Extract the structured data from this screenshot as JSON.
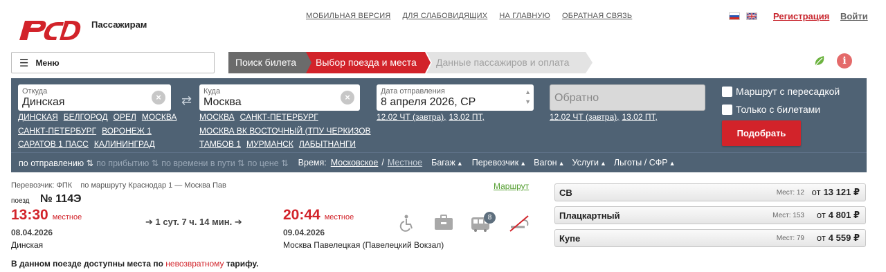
{
  "header": {
    "brand_title": "Пассажирам",
    "nav": [
      "МОБИЛЬНАЯ ВЕРСИЯ",
      "ДЛЯ СЛАБОВИДЯЩИХ",
      "НА ГЛАВНУЮ",
      "ОБРАТНАЯ СВЯЗЬ"
    ],
    "register": "Регистрация",
    "login": "Войти"
  },
  "menu": {
    "label": "Меню"
  },
  "steps": [
    "Поиск билета",
    "Выбор поезда и места",
    "Данные пассажиров и оплата"
  ],
  "search": {
    "from": {
      "label": "Откуда",
      "value": "Динская",
      "quick": [
        [
          "ДИНСКАЯ",
          "БЕЛГОРОД",
          "ОРЕЛ",
          "МОСКВА"
        ],
        [
          "САНКТ-ПЕТЕРБУРГ",
          "ВОРОНЕЖ 1"
        ],
        [
          "САРАТОВ 1 ПАСС",
          "КАЛИНИНГРАД"
        ]
      ]
    },
    "to": {
      "label": "Куда",
      "value": "Москва",
      "quick": [
        [
          "МОСКВА",
          "САНКТ-ПЕТЕРБУРГ"
        ],
        [
          "МОСКВА ВК ВОСТОЧНЫЙ (ТПУ ЧЕРКИЗОВ"
        ],
        [
          "ТАМБОВ 1",
          "МУРМАНСК",
          "ЛАБЫТНАНГИ"
        ]
      ]
    },
    "date": {
      "label": "Дата отправления",
      "value": "8 апреля 2026, СР",
      "quick": [
        "12.02 ЧТ (завтра),",
        "13.02 ПТ,"
      ]
    },
    "back": {
      "placeholder": "Обратно",
      "quick": [
        "12.02 ЧТ (завтра),",
        "13.02 ПТ,"
      ]
    },
    "transfer_label": "Маршрут с пересадкой",
    "tickets_only_label": "Только с билетами",
    "submit": "Подобрать"
  },
  "sortbar": {
    "by_departure": "по отправлению",
    "by_arrival": "по прибытию",
    "by_travel_time": "по времени в пути",
    "by_price": "по цене",
    "time_label": "Время:",
    "time_moscow": "Московское",
    "time_sep": "/",
    "time_local": "Местное",
    "baggage": "Багаж",
    "carrier": "Перевозчик",
    "wagon": "Вагон",
    "services": "Услуги",
    "benefits": "Льготы / СФР"
  },
  "train": {
    "carrier_line": "Перевозчик: ФПК    по маршруту Краснодар 1 — Москва Пав",
    "route_link": "Маршрут",
    "train_label": "поезд",
    "number": "№ 114Э",
    "departure": {
      "time": "13:30",
      "note": "местное",
      "date": "08.04.2026",
      "station": "Динская"
    },
    "duration": "1 сут. 7 ч. 14 мин.",
    "arrival": {
      "time": "20:44",
      "note": "местное",
      "date": "09.04.2026",
      "station": "Москва Павелецкая (Павелецкий Вокзал)"
    },
    "wagon_badge": "8",
    "notice_prefix": "В данном поезде доступны места по",
    "notice_highlight": "невозвратному",
    "notice_suffix": "тарифу."
  },
  "classes": [
    {
      "name": "СВ",
      "seats": "Мест: 12",
      "from": "от",
      "price": "13 121 ₽"
    },
    {
      "name": "Плацкартный",
      "seats": "Мест: 153",
      "from": "от",
      "price": "4 801 ₽"
    },
    {
      "name": "Купе",
      "seats": "Мест: 79",
      "from": "от",
      "price": "4 559 ₽"
    }
  ],
  "colors": {
    "brand_red": "#d2232a",
    "panel": "#4f6274",
    "link_green": "#57a034"
  }
}
